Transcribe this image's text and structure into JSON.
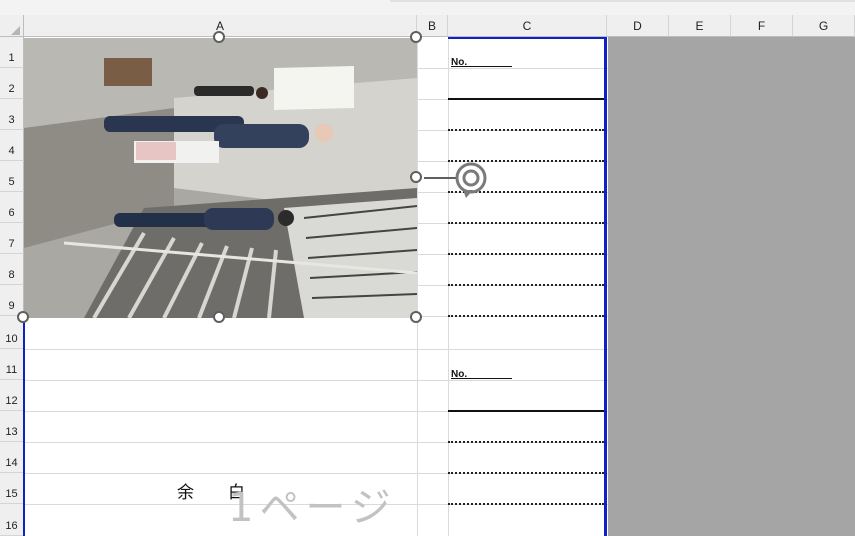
{
  "columns": [
    "A",
    "B",
    "C",
    "D",
    "E",
    "F",
    "G"
  ],
  "rows": [
    "1",
    "2",
    "3",
    "4",
    "5",
    "6",
    "7",
    "8",
    "9",
    "10",
    "11",
    "12",
    "13",
    "14",
    "15",
    "16"
  ],
  "form": {
    "no_label_1": "No.",
    "no_label_2": "No."
  },
  "blank_text": "余　　白",
  "page_watermark": "1ページ",
  "colors": {
    "print_area_border": "#1020c8",
    "outside_print_area": "#a5a5a5",
    "header_bg": "#efefef"
  },
  "icons": {
    "rotate_handle": "rotate-icon",
    "select_all": "select-all-triangle-icon"
  }
}
